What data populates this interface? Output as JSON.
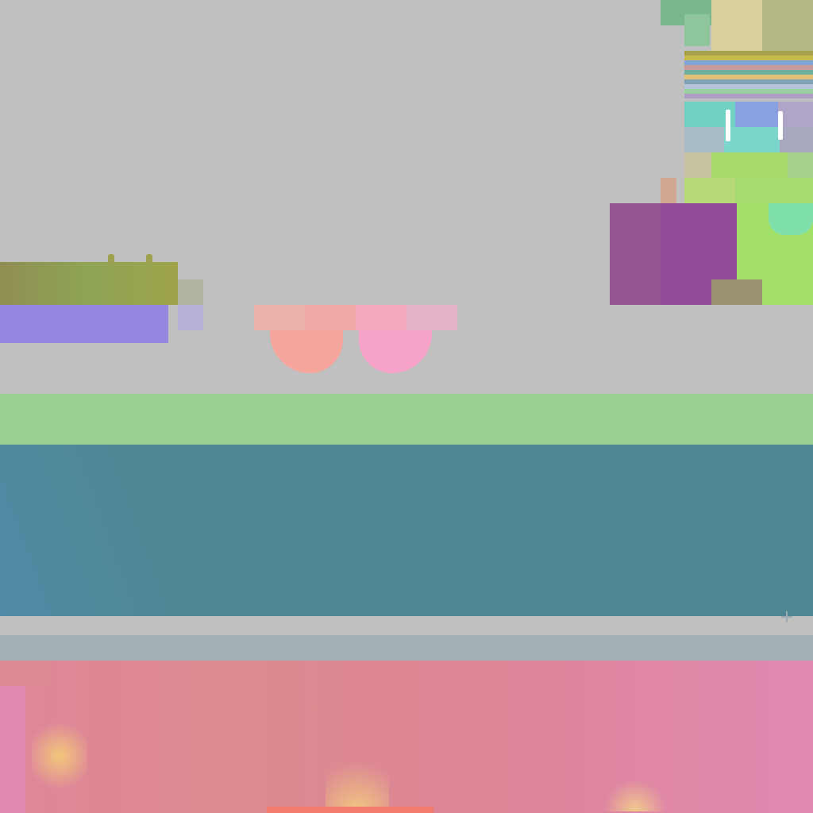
{
  "colors": {
    "background": "#c0c0c0",
    "olive_bar": "#8f8e52",
    "violet_bar": "#9387df",
    "grey_chip": "#b3b3a2",
    "lavender_chip": "#b7b2d6",
    "coral_chip": "#f2a7a4",
    "pink_chip": "#f4a4c6",
    "green_band": "#9cd291",
    "teal_panel": "#4f8895",
    "grey_strip": "#a3afb3",
    "pink_panel": "#dc8b99",
    "magenta_block": "#914b98",
    "lime_block": "#a2e068",
    "khaki_block": "#9a9273"
  },
  "icons": [
    "dots-icon",
    "handle-icon",
    "crosshair-icon"
  ]
}
